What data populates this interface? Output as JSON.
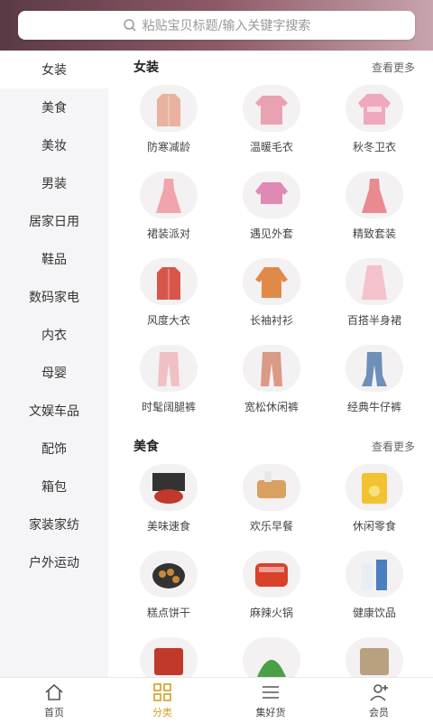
{
  "search": {
    "placeholder": "粘贴宝贝标题/输入关键字搜索",
    "icon": "search-icon"
  },
  "sidebar": {
    "items": [
      {
        "label": "女装",
        "active": true
      },
      {
        "label": "美食"
      },
      {
        "label": "美妆"
      },
      {
        "label": "男装"
      },
      {
        "label": "居家日用"
      },
      {
        "label": "鞋品"
      },
      {
        "label": "数码家电"
      },
      {
        "label": "内衣"
      },
      {
        "label": "母婴"
      },
      {
        "label": "文娱车品"
      },
      {
        "label": "配饰"
      },
      {
        "label": "箱包"
      },
      {
        "label": "家装家纺"
      },
      {
        "label": "户外运动"
      }
    ]
  },
  "sections": [
    {
      "title": "女装",
      "more": "查看更多",
      "items": [
        {
          "label": "防寒减龄",
          "icon": "coat-icon",
          "color": "#e7b3a0"
        },
        {
          "label": "温暖毛衣",
          "icon": "sweater-icon",
          "color": "#e8a2b2"
        },
        {
          "label": "秋冬卫衣",
          "icon": "hoodie-icon",
          "color": "#f0a8bd"
        },
        {
          "label": "裙装派对",
          "icon": "dress-icon",
          "color": "#f1a4ac"
        },
        {
          "label": "遇见外套",
          "icon": "jacket-icon",
          "color": "#df8ab5"
        },
        {
          "label": "精致套装",
          "icon": "dress-icon",
          "color": "#e98a90"
        },
        {
          "label": "风度大衣",
          "icon": "coat-icon",
          "color": "#d6574a"
        },
        {
          "label": "长袖衬衫",
          "icon": "shirt-icon",
          "color": "#e08a4a"
        },
        {
          "label": "百搭半身裙",
          "icon": "skirt-icon",
          "color": "#f3c2cc"
        },
        {
          "label": "时髦阔腿裤",
          "icon": "pants-icon",
          "color": "#f0c0c4"
        },
        {
          "label": "宽松休闲裤",
          "icon": "pants-icon",
          "color": "#d99a86"
        },
        {
          "label": "经典牛仔裤",
          "icon": "jeans-icon",
          "color": "#6d8fb8"
        }
      ]
    },
    {
      "title": "美食",
      "more": "查看更多",
      "items": [
        {
          "label": "美味速食",
          "icon": "noodle-box-icon",
          "color": "#c0392b"
        },
        {
          "label": "欢乐早餐",
          "icon": "bread-icon",
          "color": "#d9a060"
        },
        {
          "label": "休闲零食",
          "icon": "snack-bag-icon",
          "color": "#f2c230"
        },
        {
          "label": "糕点饼干",
          "icon": "cookie-icon",
          "color": "#c8883a"
        },
        {
          "label": "麻辣火锅",
          "icon": "hotpot-icon",
          "color": "#d9412b"
        },
        {
          "label": "健康饮品",
          "icon": "drink-icon",
          "color": "#4a7fc1"
        },
        {
          "label": "",
          "icon": "food-box-icon",
          "color": "#c0392b"
        },
        {
          "label": "",
          "icon": "veggie-icon",
          "color": "#4aa048"
        },
        {
          "label": "",
          "icon": "food-box-icon",
          "color": "#b8a080"
        }
      ]
    }
  ],
  "tabbar": {
    "items": [
      {
        "label": "首页",
        "icon": "home-icon"
      },
      {
        "label": "分类",
        "icon": "category-icon",
        "active": true
      },
      {
        "label": "集好货",
        "icon": "list-icon"
      },
      {
        "label": "会员",
        "icon": "member-icon"
      }
    ]
  },
  "colors": {
    "accent": "#d4a020",
    "header_start": "#5a3a46",
    "header_end": "#c7a4ac",
    "sidebar_bg": "#f5f4f6"
  }
}
